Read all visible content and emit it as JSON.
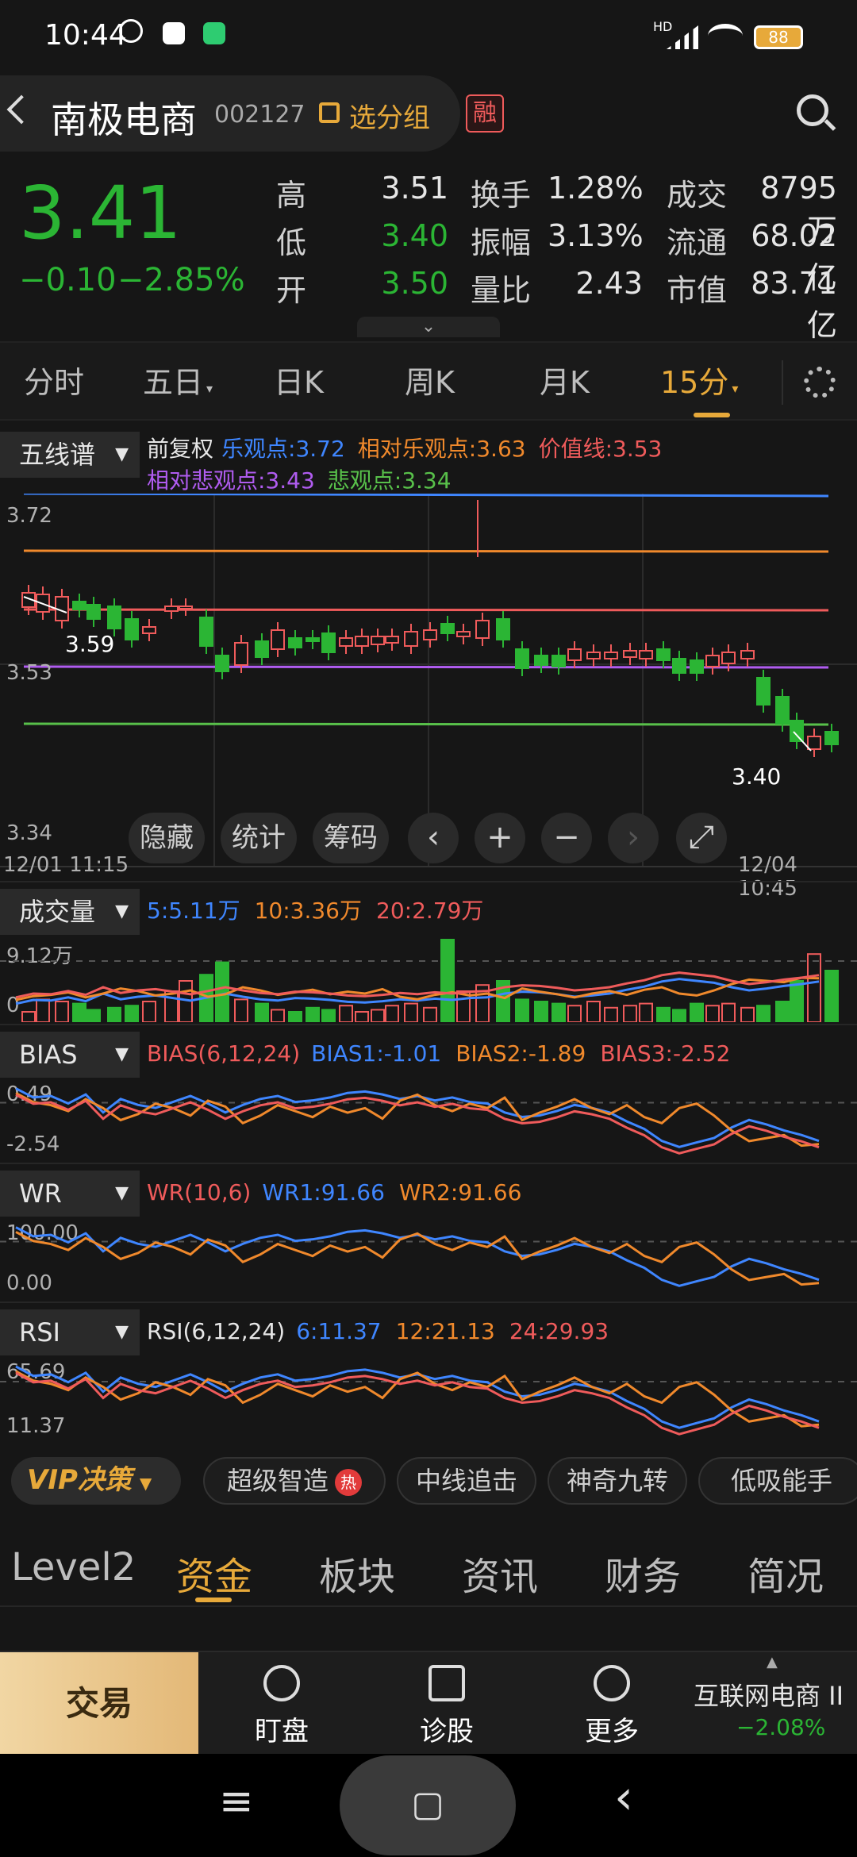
{
  "status": {
    "time": "10:44",
    "battery": "88",
    "net": "HD"
  },
  "header": {
    "back_icon": "chevron-left-icon",
    "name": "南极电商",
    "code": "002127",
    "group_label": "选分组",
    "margin_badge": "融",
    "search_icon": "search-icon"
  },
  "quote": {
    "price": "3.41",
    "change": "−0.10",
    "change_pct": "−2.85%",
    "fields": [
      {
        "label": "高",
        "value": "3.51",
        "color": "#e6e6e6"
      },
      {
        "label": "低",
        "value": "3.40",
        "color": "#2bb534"
      },
      {
        "label": "开",
        "value": "3.50",
        "color": "#2bb534"
      },
      {
        "label": "换手",
        "value": "1.28%"
      },
      {
        "label": "振幅",
        "value": "3.13%"
      },
      {
        "label": "量比",
        "value": "2.43"
      },
      {
        "label": "成交",
        "value": "8795万"
      },
      {
        "label": "流通",
        "value": "68.02亿"
      },
      {
        "label": "市值",
        "value": "83.71亿"
      }
    ]
  },
  "tabs": {
    "items": [
      "分时",
      "五日",
      "日K",
      "周K",
      "月K",
      "15分"
    ],
    "active": "15分"
  },
  "kline": {
    "indicator": "五线谱",
    "adjust": "前复权",
    "lines": [
      {
        "label": "乐观点:3.72",
        "color": "#3f86ff"
      },
      {
        "label": "相对乐观点:3.63",
        "color": "#f0892c"
      },
      {
        "label": "价值线:3.53",
        "color": "#ef5b5b"
      },
      {
        "label": "相对悲观点:3.43",
        "color": "#b05cf0"
      },
      {
        "label": "悲观点:3.34",
        "color": "#58c04a"
      }
    ],
    "y_ticks": [
      "3.72",
      "3.53",
      "3.34"
    ],
    "x_start": "12/01 11:15",
    "x_end": "12/04 10:45",
    "ann_high": "3.59",
    "ann_low": "3.40",
    "buttons": {
      "hide": "隐藏",
      "stats": "统计",
      "chips": "筹码"
    },
    "tools": {
      "prev": "‹",
      "zoom_in": "+",
      "zoom_out": "−",
      "next": "›",
      "fullscreen": "⤢"
    }
  },
  "volume": {
    "name": "成交量",
    "ma": [
      {
        "label": "5:5.11万",
        "color": "#3f86ff"
      },
      {
        "label": "10:3.36万",
        "color": "#f0892c"
      },
      {
        "label": "20:2.79万",
        "color": "#ef5b5b"
      }
    ],
    "y_top": "9.12万",
    "y_bot": "0"
  },
  "bias": {
    "name": "BIAS",
    "params": "BIAS(6,12,24)",
    "vals": [
      {
        "label": "BIAS1:-1.01",
        "color": "#3f86ff"
      },
      {
        "label": "BIAS2:-1.89",
        "color": "#f0892c"
      },
      {
        "label": "BIAS3:-2.52",
        "color": "#ef5b5b"
      }
    ],
    "y_top": "0.49",
    "y_bot": "-2.54"
  },
  "wr": {
    "name": "WR",
    "params": "WR(10,6)",
    "vals": [
      {
        "label": "WR1:91.66",
        "color": "#3f86ff"
      },
      {
        "label": "WR2:91.66",
        "color": "#f0892c"
      }
    ],
    "y_top": "100.00",
    "y_bot": "0.00"
  },
  "rsi": {
    "name": "RSI",
    "params": "RSI(6,12,24)",
    "vals": [
      {
        "label": "6:11.37",
        "color": "#3f86ff"
      },
      {
        "label": "12:21.13",
        "color": "#f0892c"
      },
      {
        "label": "24:29.93",
        "color": "#ef5b5b"
      }
    ],
    "y_top": "65.69",
    "y_bot": "11.37"
  },
  "strategy": {
    "vip": "VIP决策",
    "chips": [
      "超级智造",
      "中线追击",
      "神奇九转",
      "低吸能手"
    ],
    "hot": "热"
  },
  "bottom_tabs": {
    "items": [
      "Level2",
      "资金",
      "板块",
      "资讯",
      "财务",
      "简况"
    ],
    "active": "资金"
  },
  "nav": {
    "trade": "交易",
    "items": [
      {
        "label": "盯盘",
        "icon": "target-icon"
      },
      {
        "label": "诊股",
        "icon": "pulse-chart-icon"
      },
      {
        "label": "更多",
        "icon": "more-icon"
      }
    ],
    "sector_name": "互联网电商 II",
    "sector_change": "−2.08%"
  },
  "sysnav": {
    "menu": "≡",
    "home": "▢",
    "back": "‹"
  },
  "colors": {
    "up": "#ef5b5b",
    "down": "#2bb534",
    "accent": "#e7a93a"
  }
}
